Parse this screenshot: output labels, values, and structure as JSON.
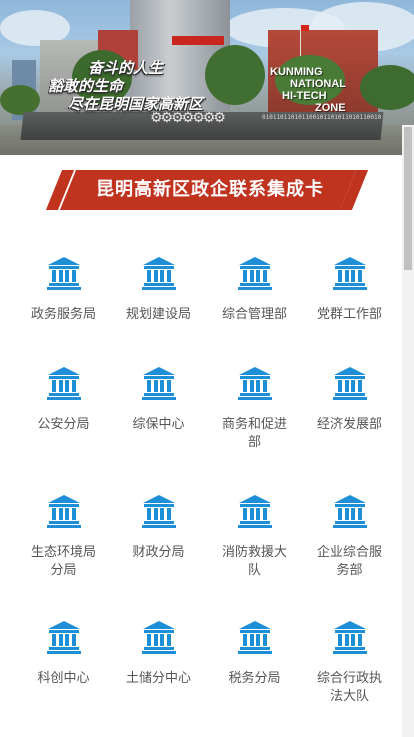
{
  "hero": {
    "slogan_lines": [
      "奋斗的人生",
      "豁敢的生命",
      "尽在昆明国家高新区"
    ],
    "english_lines": [
      "KUNMING",
      "NATIONAL",
      "HI-TECH",
      "ZONE"
    ],
    "gear_glyphs": "⚙⚙⚙⚙⚙⚙⚙",
    "binary_text": "01011011010110010110101101011001011 10110100101101011010010110101101001"
  },
  "title": "昆明高新区政企联系集成卡",
  "icon_color": "#1e8fd6",
  "accent_color": "#c0331f",
  "departments": [
    {
      "label": "政务服务局",
      "icon": "institution-icon"
    },
    {
      "label": "规划建设局",
      "icon": "institution-icon"
    },
    {
      "label": "综合管理部",
      "icon": "institution-icon"
    },
    {
      "label": "党群工作部",
      "icon": "institution-icon"
    },
    {
      "label": "公安分局",
      "icon": "institution-icon"
    },
    {
      "label": "综保中心",
      "icon": "institution-icon"
    },
    {
      "label": "商务和促进部",
      "icon": "institution-icon"
    },
    {
      "label": "经济发展部",
      "icon": "institution-icon"
    },
    {
      "label": "生态环境局分局",
      "icon": "institution-icon"
    },
    {
      "label": "财政分局",
      "icon": "institution-icon"
    },
    {
      "label": "消防救援大队",
      "icon": "institution-icon"
    },
    {
      "label": "企业综合服务部",
      "icon": "institution-icon"
    },
    {
      "label": "科创中心",
      "icon": "institution-icon"
    },
    {
      "label": "土储分中心",
      "icon": "institution-icon"
    },
    {
      "label": "税务分局",
      "icon": "institution-icon"
    },
    {
      "label": "综合行政执法大队",
      "icon": "institution-icon"
    }
  ]
}
